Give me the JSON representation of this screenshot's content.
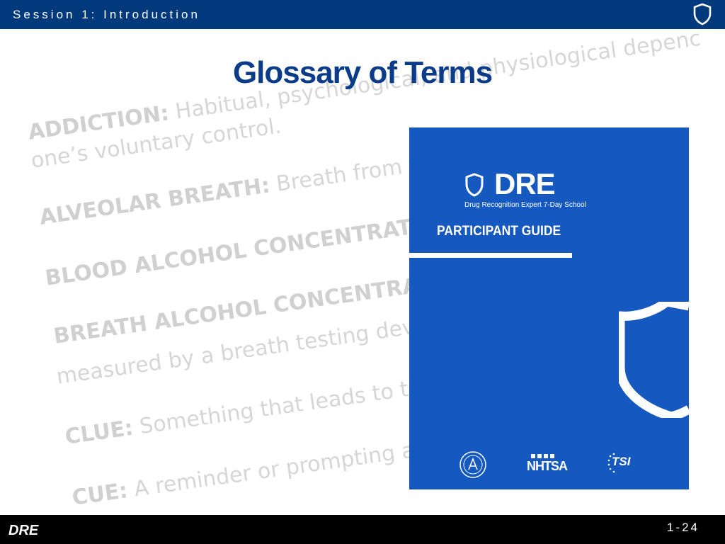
{
  "header": {
    "session_title": "Session 1: Introduction",
    "icon": "shield-icon"
  },
  "slide": {
    "title": "Glossary of Terms"
  },
  "background_terms": [
    {
      "term": "ADDICTION:",
      "definition": "Habitual, psychological, and physiological depenc"
    },
    {
      "term": "",
      "definition": "one’s voluntary control."
    },
    {
      "term": "ALVEOLAR BREATH:",
      "definition": "Breath from th"
    },
    {
      "term": "BLOOD ALCOHOL CONCENTRATION",
      "definition": ""
    },
    {
      "term": "BREATH ALCOHOL CONCENTRATIC",
      "definition": ""
    },
    {
      "term": "",
      "definition": "measured by a breath testing devic"
    },
    {
      "term": "CLUE:",
      "definition": "Something that leads to th"
    },
    {
      "term": "CUE:",
      "definition": "A reminder or prompting as"
    }
  ],
  "guide_cover": {
    "brand": "DRE",
    "subtitle": "Drug Recognition Expert 7-Day School",
    "label": "PARTICIPANT GUIDE",
    "agency_logo": "NHTSA",
    "partner_logo": "TSI",
    "colors": {
      "cover": "#1558c0",
      "text": "#ffffff"
    }
  },
  "footer": {
    "logo": "DRE",
    "page_number": "1-24"
  },
  "colors": {
    "header_bar": "#003a7d",
    "title": "#0b3c8a",
    "footer_bar": "#000000",
    "watermark_text": "#d6d6d6"
  }
}
